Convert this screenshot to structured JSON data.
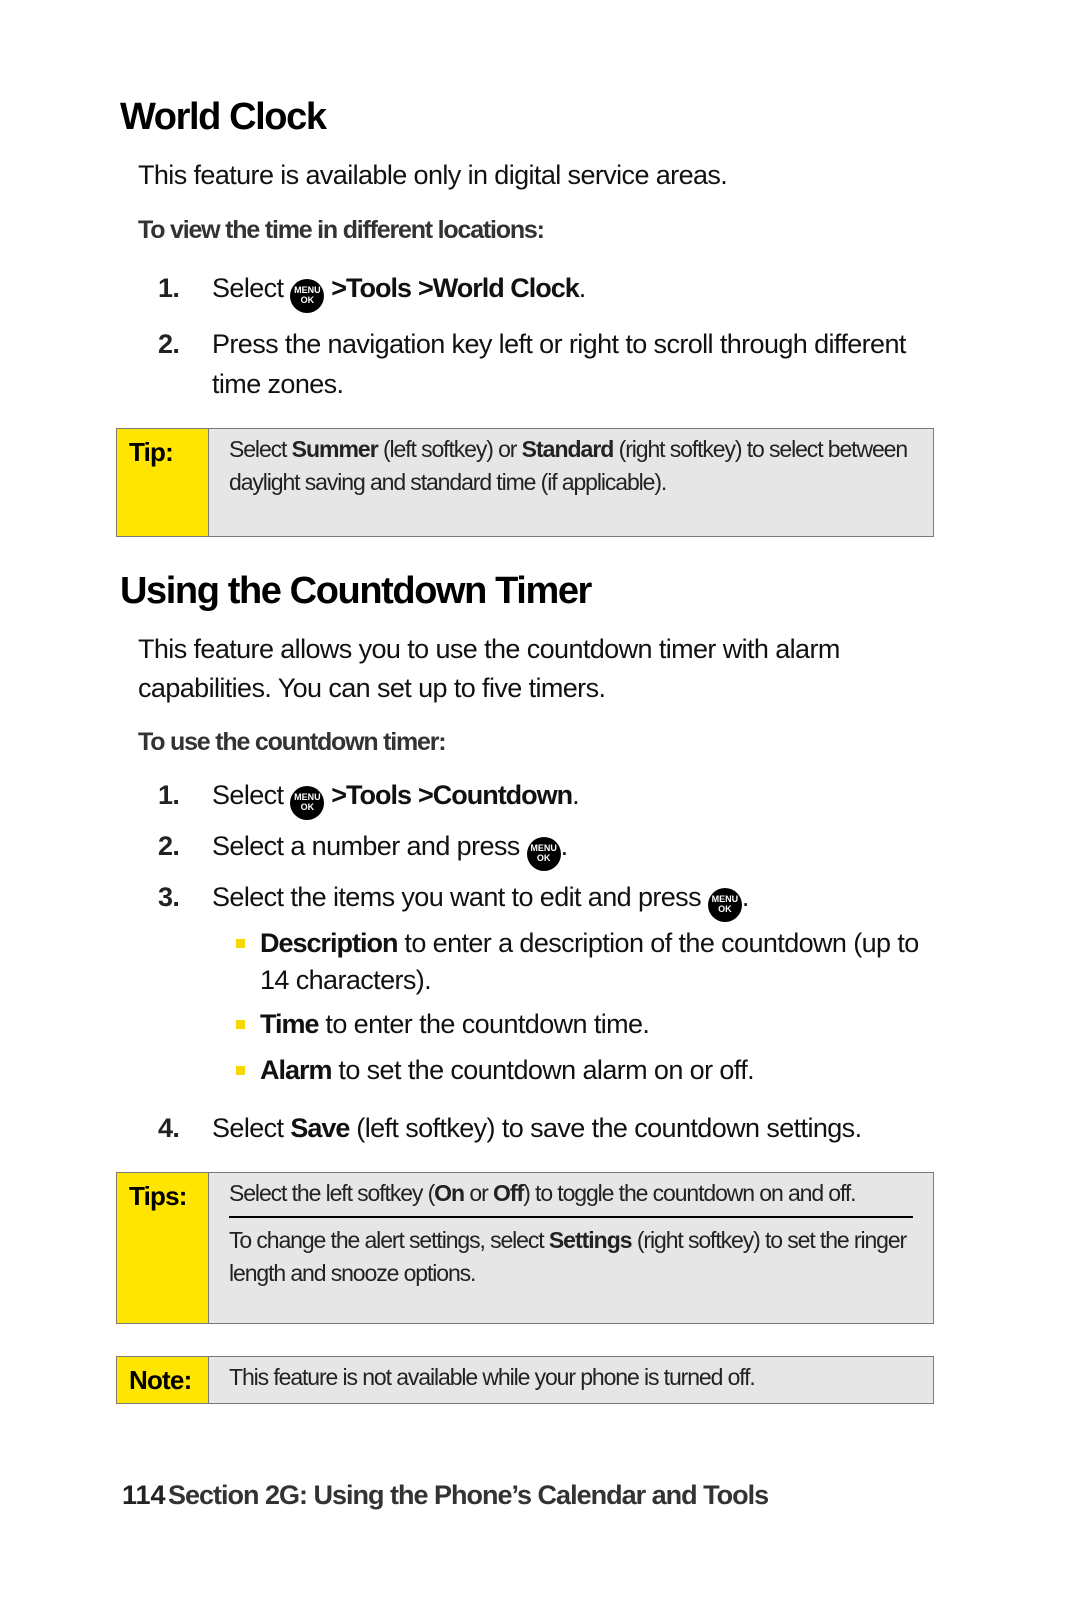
{
  "world_clock": {
    "title": "World Clock",
    "intro": "This feature is available only in digital service areas.",
    "subheading": "To view the time in different locations:",
    "steps": [
      {
        "num": "1.",
        "pre": "Select ",
        "path": [
          "Tools",
          "World Clock"
        ],
        "post": "."
      },
      {
        "num": "2.",
        "text": "Press the navigation key left or right to scroll through different time zones."
      }
    ],
    "tip": {
      "label": "Tip:",
      "parts": [
        "Select ",
        "Summer",
        " (left softkey) or ",
        "Standard",
        " (right softkey) to select between daylight saving and standard time (if applicable)."
      ]
    }
  },
  "countdown": {
    "title": "Using the Countdown Timer",
    "intro": "This feature allows you to use the countdown timer with alarm capabilities. You can set up to five timers.",
    "subheading": "To use the countdown timer:",
    "steps": [
      {
        "num": "1.",
        "pre": "Select ",
        "path": [
          "Tools",
          "Countdown"
        ],
        "post": "."
      },
      {
        "num": "2.",
        "text": "Select a number and press ",
        "post": "."
      },
      {
        "num": "3.",
        "text": "Select the items you want to edit and press ",
        "post": "."
      },
      {
        "num": "4.",
        "pre": "Select ",
        "bold": "Save",
        "post": " (left softkey) to save the countdown settings."
      }
    ],
    "bullets": [
      {
        "bold": "Description",
        "text": " to enter a description of the countdown (up to 14 characters)."
      },
      {
        "bold": "Time",
        "text": " to enter the countdown time."
      },
      {
        "bold": "Alarm",
        "text": " to set the countdown alarm on or off."
      }
    ],
    "tips": {
      "label": "Tips:",
      "tip1": [
        "Select the left softkey (",
        "On",
        " or ",
        "Off",
        ") to toggle the countdown on and off."
      ],
      "tip2": [
        "To change the alert settings, select ",
        "Settings",
        " (right softkey) to set the ringer length and snooze options."
      ]
    },
    "note": {
      "label": "Note:",
      "text": "This feature is not available while your phone is turned off."
    }
  },
  "menu_key": {
    "line1": "MENU",
    "line2": "OK",
    "icon": "menu-ok-key-icon"
  },
  "separator": ">",
  "footer": {
    "page_number": "114",
    "section_title": "Section 2G: Using the Phone’s Calendar and Tools"
  },
  "colors": {
    "accent_yellow": "#ffe500",
    "box_gray": "#e6e6e6"
  }
}
